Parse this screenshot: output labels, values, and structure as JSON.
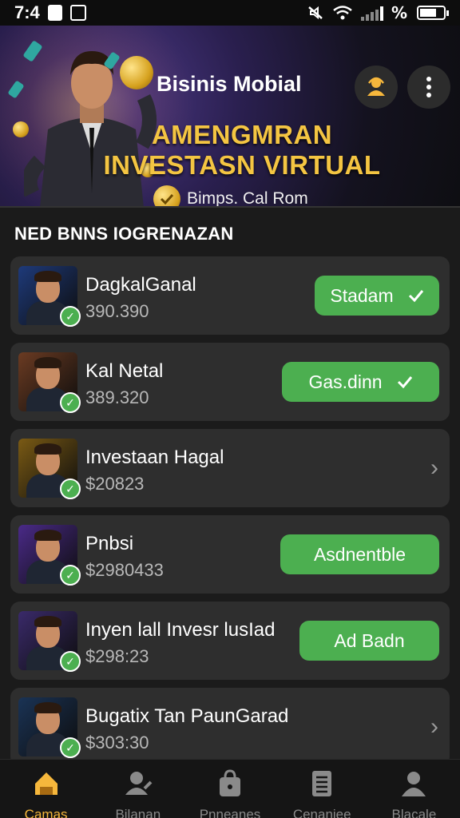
{
  "status_bar": {
    "time": "7:4"
  },
  "header": {
    "app_name": "Bisinis Mobial",
    "headline_line1": "AMENGMRAN",
    "headline_line2": "INVESTASN VIRTUAL",
    "subtitle": "Bimps. Cal Rom",
    "icons": [
      "user-badge-icon",
      "more-vertical-icon"
    ]
  },
  "section": {
    "title": "NED BNNS IOGRENAZAN"
  },
  "items": [
    {
      "title": "DagkalGanal",
      "amount": "390.390",
      "action": "Stadam",
      "action_type": "button-check",
      "thumb_color": "#1e3a7a"
    },
    {
      "title": "Kal Netal",
      "amount": "389.320",
      "action": "Gas.dinn",
      "action_type": "button-check",
      "thumb_color": "#6b3b22"
    },
    {
      "title": "Investaan Hagal",
      "amount": "$20823",
      "action": "",
      "action_type": "chevron",
      "thumb_color": "#7a5a14"
    },
    {
      "title": "Pnbsi",
      "amount": "$2980433",
      "action": "Asdnentble",
      "action_type": "button",
      "thumb_color": "#4a2a88"
    },
    {
      "title": "Inyen lall Invesr lusIad",
      "amount": "$298:23",
      "action": "Ad Badn",
      "action_type": "button",
      "thumb_color": "#3a2a6a"
    },
    {
      "title": "Bugatix Tan PaunGarad",
      "amount": "$303:30",
      "action": "",
      "action_type": "chevron",
      "thumb_color": "#1a3355"
    }
  ],
  "nav": [
    {
      "label": "Camas",
      "icon": "home-icon",
      "active": true
    },
    {
      "label": "Bilanan",
      "icon": "user-edit-icon",
      "active": false
    },
    {
      "label": "Pnneanes",
      "icon": "bag-lock-icon",
      "active": false
    },
    {
      "label": "Cenaniee",
      "icon": "document-list-icon",
      "active": false
    },
    {
      "label": "Blacale",
      "icon": "profile-icon",
      "active": false
    }
  ],
  "colors": {
    "accent": "#f4c542",
    "green": "#4caf50",
    "card": "#2e2e2e",
    "background": "#1b1b1b"
  }
}
